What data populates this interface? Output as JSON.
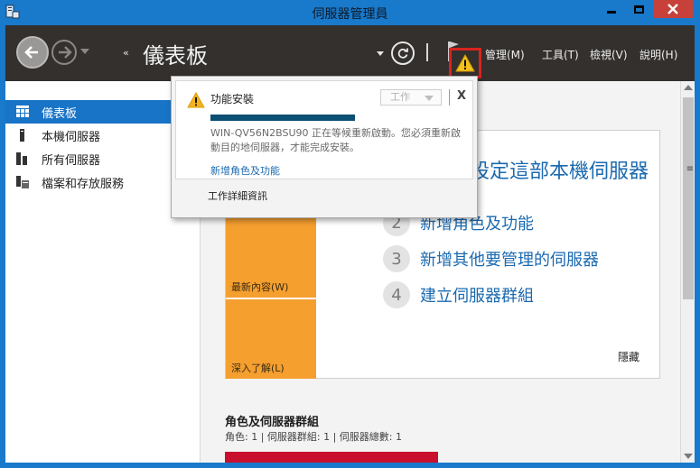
{
  "window": {
    "title": "伺服器管理員",
    "accent_color": "#1979ca"
  },
  "header": {
    "page_title": "儀表板",
    "crumb_arrows": "‹‹",
    "menus": [
      "管理(M)",
      "工具(T)",
      "檢視(V)",
      "說明(H)"
    ]
  },
  "sidebar": {
    "items": [
      {
        "label": "儀表板",
        "icon": "dashboard-icon",
        "active": true
      },
      {
        "label": "本機伺服器",
        "icon": "server-icon",
        "active": false
      },
      {
        "label": "所有伺服器",
        "icon": "servers-icon",
        "active": false
      },
      {
        "label": "檔案和存放服務",
        "icon": "file-storage-icon",
        "active": false
      }
    ]
  },
  "welcome": {
    "big_link": "設定這部本機伺服器",
    "steps": [
      {
        "num": "2",
        "text": "新增角色及功能"
      },
      {
        "num": "3",
        "text": "新增其他要管理的伺服器"
      },
      {
        "num": "4",
        "text": "建立伺服器群組"
      }
    ],
    "tiles": [
      "最新內容(W)",
      "深入了解(L)"
    ],
    "hide": "隱藏",
    "tile_color": "#f59f2f"
  },
  "roles": {
    "title": "角色及伺服器群組",
    "subtitle": "角色: 1 | 伺服器群組: 1 | 伺服器總數: 1"
  },
  "notification": {
    "title": "功能安裝",
    "task_select": "工作",
    "close": "X",
    "progress": 0.6,
    "message": "WIN-QV56N2BSU90 正在等候重新啟動。您必須重新啟動目的地伺服器，才能完成安裝。",
    "link": "新增角色及功能",
    "details": "工作詳細資訊"
  }
}
